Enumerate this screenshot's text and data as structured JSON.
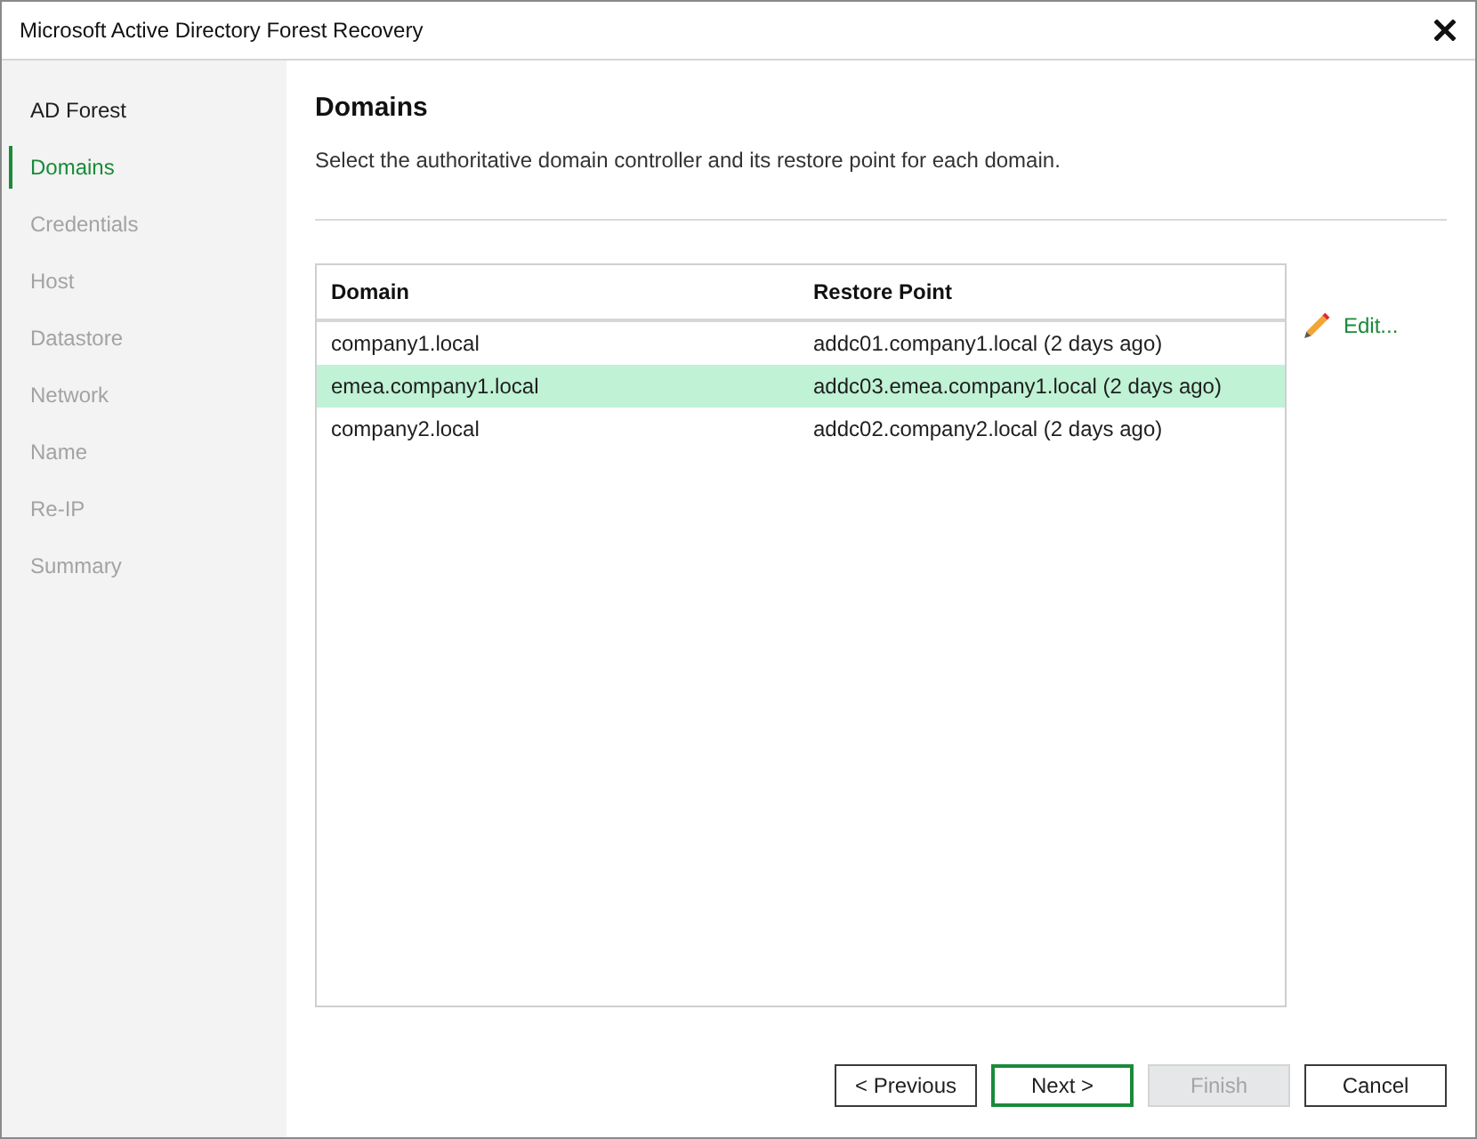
{
  "window": {
    "title": "Microsoft Active Directory Forest Recovery"
  },
  "steps": [
    {
      "label": "AD Forest",
      "selected": false,
      "disabled": false
    },
    {
      "label": "Domains",
      "selected": true,
      "disabled": false
    },
    {
      "label": "Credentials",
      "selected": false,
      "disabled": true
    },
    {
      "label": "Host",
      "selected": false,
      "disabled": true
    },
    {
      "label": "Datastore",
      "selected": false,
      "disabled": true
    },
    {
      "label": "Network",
      "selected": false,
      "disabled": true
    },
    {
      "label": "Name",
      "selected": false,
      "disabled": true
    },
    {
      "label": "Re-IP",
      "selected": false,
      "disabled": true
    },
    {
      "label": "Summary",
      "selected": false,
      "disabled": true
    }
  ],
  "page": {
    "heading": "Domains",
    "description": "Select the authoritative domain controller and its restore point for each domain."
  },
  "table": {
    "columns": [
      "Domain",
      "Restore Point"
    ],
    "rows": [
      {
        "cells": [
          "company1.local",
          "addc01.company1.local (2 days ago)"
        ],
        "selected": false
      },
      {
        "cells": [
          "emea.company1.local",
          "addc03.emea.company1.local (2 days ago)"
        ],
        "selected": true
      },
      {
        "cells": [
          "company2.local",
          "addc02.company2.local (2 days ago)"
        ],
        "selected": false
      }
    ]
  },
  "edit_link": {
    "label": "Edit..."
  },
  "buttons": [
    {
      "label": "< Previous",
      "default": false,
      "disabled": false
    },
    {
      "label": "Next >",
      "default": true,
      "disabled": false
    },
    {
      "label": "Finish",
      "default": false,
      "disabled": true
    },
    {
      "label": "Cancel",
      "default": false,
      "disabled": false
    }
  ]
}
